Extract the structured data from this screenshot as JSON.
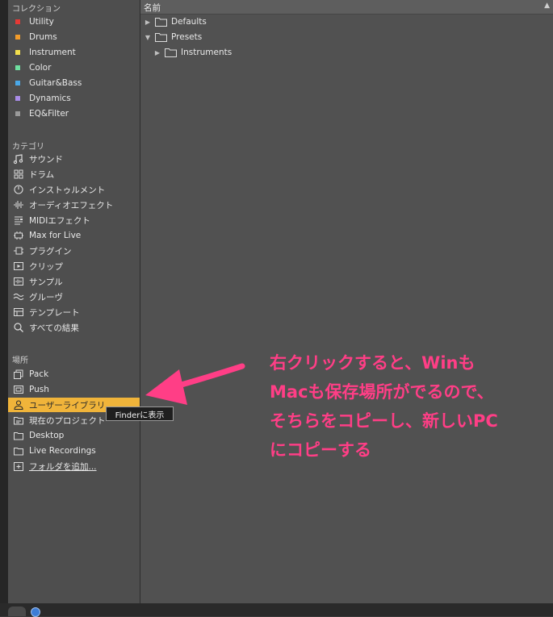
{
  "sidebar": {
    "collections_title": "コレクション",
    "collections": [
      {
        "label": "Utility",
        "color": "#e53935"
      },
      {
        "label": "Drums",
        "color": "#f39c2a"
      },
      {
        "label": "Instrument",
        "color": "#f4e04d"
      },
      {
        "label": "Color",
        "color": "#6fe0a0"
      },
      {
        "label": "Guitar&Bass",
        "color": "#4aa8e8"
      },
      {
        "label": "Dynamics",
        "color": "#a98ce8"
      },
      {
        "label": "EQ&Filter",
        "color": "#9a9a9a"
      }
    ],
    "categories_title": "カテゴリ",
    "categories": [
      {
        "label": "サウンド",
        "icon": "music-note-icon"
      },
      {
        "label": "ドラム",
        "icon": "drum-pads-icon"
      },
      {
        "label": "インストゥルメント",
        "icon": "instrument-clock-icon"
      },
      {
        "label": "オーディオエフェクト",
        "icon": "audio-wave-icon"
      },
      {
        "label": "MIDIエフェクト",
        "icon": "midi-effect-icon"
      },
      {
        "label": "Max for Live",
        "icon": "max-device-icon"
      },
      {
        "label": "プラグイン",
        "icon": "plugin-icon"
      },
      {
        "label": "クリップ",
        "icon": "clip-icon"
      },
      {
        "label": "サンプル",
        "icon": "sample-icon"
      },
      {
        "label": "グルーヴ",
        "icon": "groove-icon"
      },
      {
        "label": "テンプレート",
        "icon": "template-icon"
      },
      {
        "label": "すべての結果",
        "icon": "search-icon"
      }
    ],
    "places_title": "場所",
    "places": [
      {
        "label": "Pack",
        "icon": "pack-icon"
      },
      {
        "label": "Push",
        "icon": "push-icon"
      },
      {
        "label": "ユーザーライブラリ",
        "icon": "user-icon"
      },
      {
        "label": "現在のプロジェクト",
        "icon": "project-folder-icon"
      },
      {
        "label": "Desktop",
        "icon": "folder-icon"
      },
      {
        "label": "Live Recordings",
        "icon": "folder-icon"
      },
      {
        "label": "フォルダを追加...",
        "icon": "add-folder-icon"
      }
    ]
  },
  "main": {
    "column_header": "名前",
    "tree": [
      {
        "label": "Defaults",
        "expanded": false,
        "depth": 0
      },
      {
        "label": "Presets",
        "expanded": true,
        "depth": 0
      },
      {
        "label": "Instruments",
        "expanded": false,
        "depth": 1
      }
    ]
  },
  "tooltip": {
    "label": "Finderに表示"
  },
  "annotation": {
    "lines": [
      "右クリックすると、Winも",
      "Macも保存場所がでるので、",
      "そちらをコピーし、新しいPC",
      "にコピーする"
    ],
    "color": "#ff3e86"
  }
}
